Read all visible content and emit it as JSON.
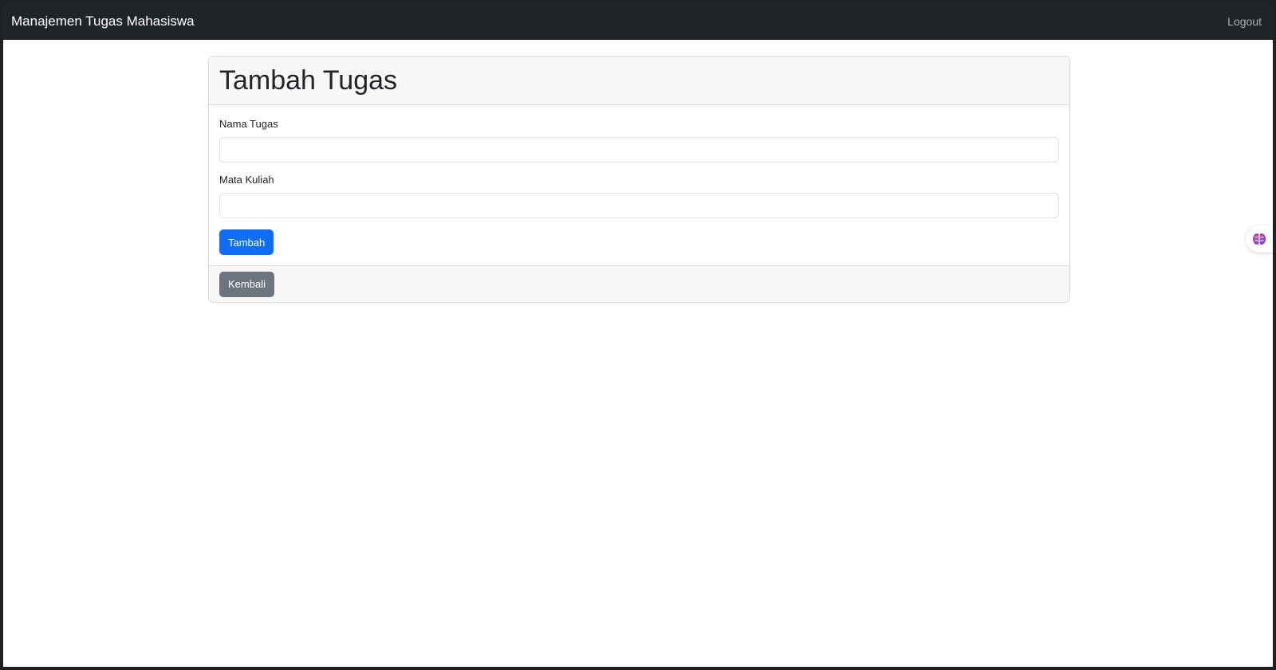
{
  "navbar": {
    "brand": "Manajemen Tugas Mahasiswa",
    "logout": "Logout"
  },
  "card": {
    "title": "Tambah Tugas",
    "fields": [
      {
        "label": "Nama Tugas",
        "value": ""
      },
      {
        "label": "Mata Kuliah",
        "value": ""
      }
    ],
    "submit_label": "Tambah",
    "back_label": "Kembali"
  },
  "widget": {
    "icon": "brain-icon"
  },
  "colors": {
    "navbar_bg": "#212529",
    "primary": "#0d6efd",
    "secondary": "#6c757d"
  }
}
